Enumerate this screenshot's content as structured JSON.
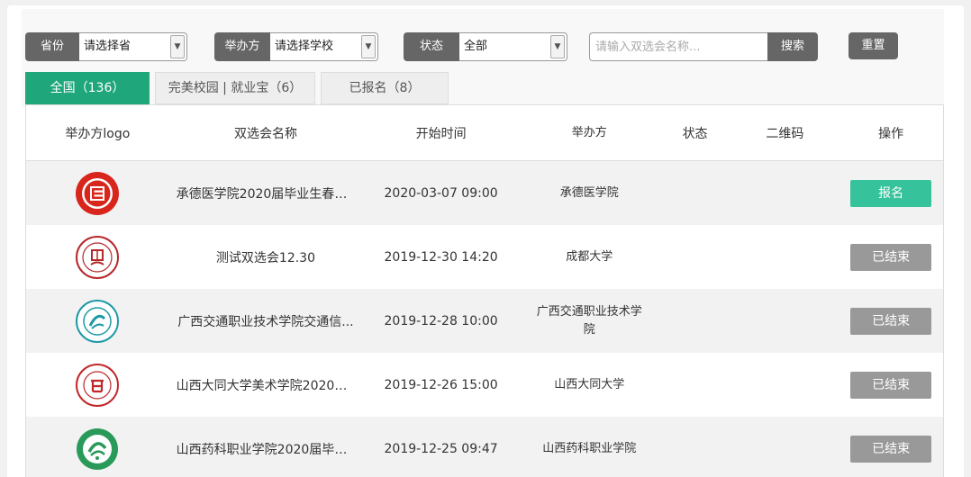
{
  "filters": {
    "province": {
      "label": "省份",
      "value": "请选择省"
    },
    "organizer": {
      "label": "举办方",
      "value": "请选择学校"
    },
    "status": {
      "label": "状态",
      "value": "全部"
    }
  },
  "search": {
    "placeholder": "请输入双选会名称...",
    "button_label": "搜索"
  },
  "reset_label": "重置",
  "tabs": [
    {
      "label": "全国（136）",
      "active": true
    },
    {
      "label": "完美校园 | 就业宝（6）",
      "active": false
    },
    {
      "label": "已报名（8）",
      "active": false
    }
  ],
  "table": {
    "headers": [
      "举办方logo",
      "双选会名称",
      "开始时间",
      "举办方",
      "状态",
      "二维码",
      "操作"
    ],
    "rows": [
      {
        "logo": "chengde-medical-logo",
        "name": "承德医学院2020届毕业生春季...",
        "time": "2020-03-07 09:00",
        "org": "承德医学院",
        "action": "报名"
      },
      {
        "logo": "chengdu-university-logo",
        "name": "测试双选会12.30",
        "time": "2019-12-30 14:20",
        "org": "成都大学",
        "action": "已结束"
      },
      {
        "logo": "guangxi-transport-logo",
        "name": "广西交通职业技术学院交通信...",
        "time": "2019-12-28 10:00",
        "org": "广西交通职业技术学院",
        "action": "已结束"
      },
      {
        "logo": "shanxi-datong-logo",
        "name": "山西大同大学美术学院2020届...",
        "time": "2019-12-26 15:00",
        "org": "山西大同大学",
        "action": "已结束"
      },
      {
        "logo": "shanxi-pharma-logo",
        "name": "山西药科职业学院2020届毕业...",
        "time": "2019-12-25 09:47",
        "org": "山西药科职业学院",
        "action": "已结束"
      }
    ]
  },
  "colors": {
    "accent": "#1fa67a",
    "apply": "#36c29a",
    "ended": "#999999",
    "label_bg": "#666666"
  }
}
